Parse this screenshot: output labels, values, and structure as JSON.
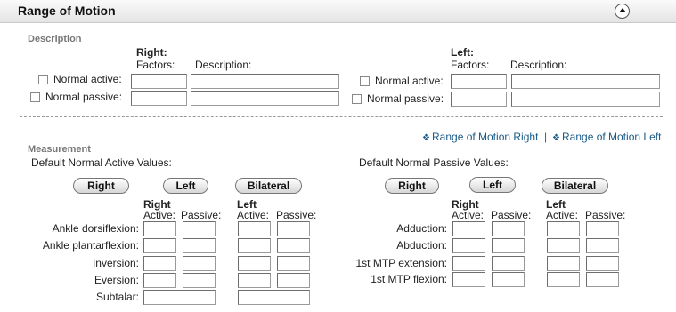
{
  "header": {
    "title": "Range of Motion"
  },
  "description": {
    "section_label": "Description",
    "right": {
      "side_label": "Right:",
      "factors_label": "Factors:",
      "description_label": "Description:",
      "rows": [
        {
          "label": "Normal active:"
        },
        {
          "label": "Normal passive:"
        }
      ]
    },
    "left": {
      "side_label": "Left:",
      "factors_label": "Factors:",
      "description_label": "Description:",
      "rows": [
        {
          "label": "Normal active:"
        },
        {
          "label": "Normal passive:"
        }
      ]
    }
  },
  "links": {
    "right": "Range of Motion Right",
    "separator": "|",
    "left": "Range of Motion Left",
    "arrow": "❖"
  },
  "measurement": {
    "section_label": "Measurement",
    "active_defaults_label": "Default Normal Active Values:",
    "passive_defaults_label": "Default Normal Passive Values:",
    "buttons": {
      "right": "Right",
      "left": "Left",
      "bilateral": "Bilateral"
    },
    "col_right": "Right",
    "col_left": "Left",
    "col_active": "Active:",
    "col_passive": "Passive:",
    "active_rows": [
      "Ankle dorsiflexion:",
      "Ankle plantarflexion:",
      "Inversion:",
      "Eversion:",
      "Subtalar:"
    ],
    "passive_rows": [
      "Adduction:",
      "Abduction:",
      "1st MTP extension:",
      "1st MTP flexion:"
    ]
  }
}
